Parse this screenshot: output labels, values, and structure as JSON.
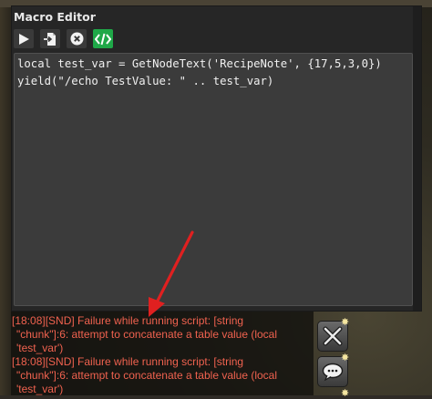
{
  "window": {
    "title": "Macro Editor"
  },
  "toolbar": {
    "buttons": [
      {
        "name": "run",
        "icon": "play-icon"
      },
      {
        "name": "import",
        "icon": "import-file-icon"
      },
      {
        "name": "stop",
        "icon": "close-circle-icon"
      },
      {
        "name": "code",
        "icon": "code-icon",
        "active": true
      }
    ]
  },
  "editor": {
    "lines": [
      "local test_var = GetNodeText('RecipeNote', {17,5,3,0})",
      "yield(\"/echo TestValue: \" .. test_var)"
    ]
  },
  "chat": {
    "lines": [
      "[18:08][SND] Failure while running script: [string",
      "\"chunk\"]:6: attempt to concatenate a table value (local",
      "'test_var')",
      "[18:08][SND] Failure while running script: [string",
      "\"chunk\"]:6: attempt to concatenate a table value (local",
      "'test_var')"
    ]
  },
  "side_buttons": [
    {
      "name": "close",
      "icon": "x-icon"
    },
    {
      "name": "chat",
      "icon": "speech-bubble-icon"
    }
  ],
  "colors": {
    "accent": "#1fa848",
    "error_text": "#f0624f",
    "annotation_arrow": "#e02020"
  }
}
